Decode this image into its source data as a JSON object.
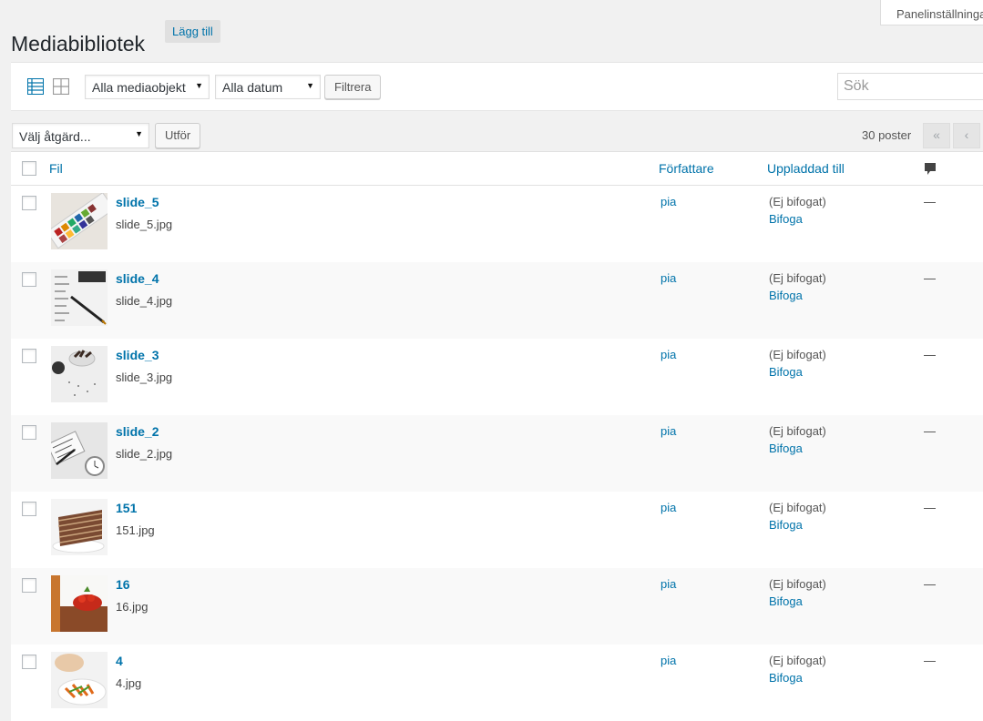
{
  "screen_options": "Panelinställningar",
  "header": {
    "title": "Mediabibliotek",
    "add_new": "Lägg till"
  },
  "filters": {
    "media_type": "Alla mediaobjekt",
    "dates": "Alla datum",
    "filter_button": "Filtrera",
    "search_placeholder": "Sök"
  },
  "bulk": {
    "action": "Välj åtgärd...",
    "apply": "Utför"
  },
  "pagination": {
    "count": "30 poster",
    "first": "«",
    "prev": "‹"
  },
  "columns": {
    "file": "Fil",
    "author": "Författare",
    "uploaded_to": "Uppladdad till"
  },
  "icons": {
    "list_view": "list-view-icon",
    "grid_view": "grid-view-icon",
    "comments": "comment-bubble-icon",
    "dropdown": "caret-down-icon"
  },
  "colors": {
    "link": "#0073aa",
    "list_view_active": "#0073aa",
    "alt_row": "#f9f9f9"
  },
  "rows": [
    {
      "title": "slide_5",
      "file": "slide_5.jpg",
      "author": "pia",
      "uploaded": "(Ej bifogat)",
      "attach": "Bifoga",
      "comments": "—"
    },
    {
      "title": "slide_4",
      "file": "slide_4.jpg",
      "author": "pia",
      "uploaded": "(Ej bifogat)",
      "attach": "Bifoga",
      "comments": "—"
    },
    {
      "title": "slide_3",
      "file": "slide_3.jpg",
      "author": "pia",
      "uploaded": "(Ej bifogat)",
      "attach": "Bifoga",
      "comments": "—"
    },
    {
      "title": "slide_2",
      "file": "slide_2.jpg",
      "author": "pia",
      "uploaded": "(Ej bifogat)",
      "attach": "Bifoga",
      "comments": "—"
    },
    {
      "title": "151",
      "file": "151.jpg",
      "author": "pia",
      "uploaded": "(Ej bifogat)",
      "attach": "Bifoga",
      "comments": "—"
    },
    {
      "title": "16",
      "file": "16.jpg",
      "author": "pia",
      "uploaded": "(Ej bifogat)",
      "attach": "Bifoga",
      "comments": "—"
    },
    {
      "title": "4",
      "file": "4.jpg",
      "author": "pia",
      "uploaded": "(Ej bifogat)",
      "attach": "Bifoga",
      "comments": "—"
    }
  ]
}
